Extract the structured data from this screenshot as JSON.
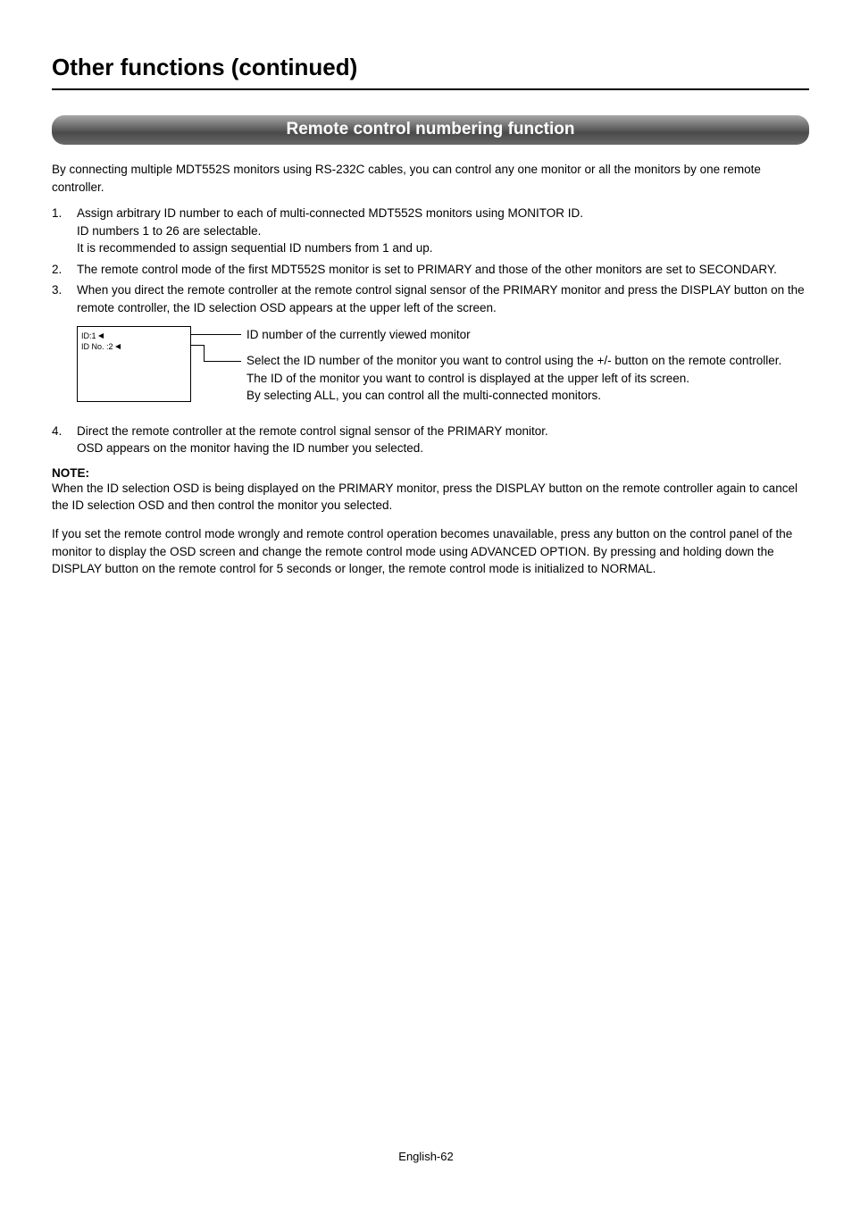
{
  "page_title": "Other functions (continued)",
  "section_banner": "Remote control numbering function",
  "intro": "By connecting multiple MDT552S monitors using RS-232C cables, you can control any one monitor or all the monitors by one remote controller.",
  "steps": {
    "s1": {
      "num": "1.",
      "l1": "Assign arbitrary ID number to each of multi-connected MDT552S monitors using MONITOR ID.",
      "l2": "ID numbers 1 to 26 are selectable.",
      "l3": "It is recommended to assign sequential ID numbers from 1 and up."
    },
    "s2": {
      "num": "2.",
      "text": "The remote control mode of the first MDT552S monitor is set to PRIMARY and those of the other monitors are set to SECONDARY."
    },
    "s3": {
      "num": "3.",
      "text": "When you direct the remote controller at the remote control signal sensor of the PRIMARY monitor and press the DISPLAY button on the remote controller, the ID selection OSD appears at the upper left of the screen."
    },
    "s4": {
      "num": "4.",
      "l1": "Direct the remote controller at the remote control signal sensor of the PRIMARY monitor.",
      "l2": "OSD appears on the monitor having the ID number you selected."
    }
  },
  "osd": {
    "line1": "ID:1",
    "line2": "ID No. :2"
  },
  "callouts": {
    "c1": "ID number of the currently viewed monitor",
    "c2l1": "Select the ID number of the monitor you want to control using the +/- button on the remote controller.",
    "c2l2": "The ID of the monitor you want to control is displayed at the upper left of its screen.",
    "c2l3": "By selecting ALL, you can control all the multi-connected monitors."
  },
  "note_label": "NOTE:",
  "note_body_1": "When the ID selection OSD is being displayed on the PRIMARY monitor, press the DISPLAY button on the remote controller again to cancel the ID selection OSD and then control the monitor you selected.",
  "note_body_2": "If you set the remote control mode wrongly and remote control operation becomes unavailable, press any button on the control panel of the monitor to display the OSD screen and change the remote control mode using ADVANCED OPTION. By pressing and holding down the DISPLAY button on the remote control for 5 seconds or longer, the remote control mode is initialized to NORMAL.",
  "footer": "English-62"
}
